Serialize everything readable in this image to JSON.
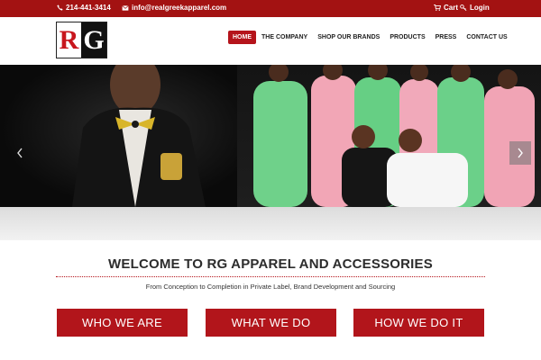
{
  "topbar": {
    "phone": "214-441-3414",
    "email": "info@realgreekapparel.com",
    "cart_label": "Cart",
    "login_label": "Login"
  },
  "logo": {
    "letter1": "R",
    "letter2": "G"
  },
  "nav": {
    "items": [
      "HOME",
      "THE COMPANY",
      "SHOP OUR BRANDS",
      "PRODUCTS",
      "PRESS",
      "CONTACT US"
    ],
    "active": "HOME"
  },
  "colors": {
    "brand_red": "#b2151b",
    "topbar_red": "#a31212"
  },
  "welcome": {
    "title": "WELCOME TO RG APPAREL AND ACCESSORIES",
    "tagline": "From Conception to Completion in Private Label, Brand Development and Sourcing"
  },
  "cta": [
    "WHO WE ARE",
    "WHAT WE DO",
    "HOW WE DO IT"
  ]
}
